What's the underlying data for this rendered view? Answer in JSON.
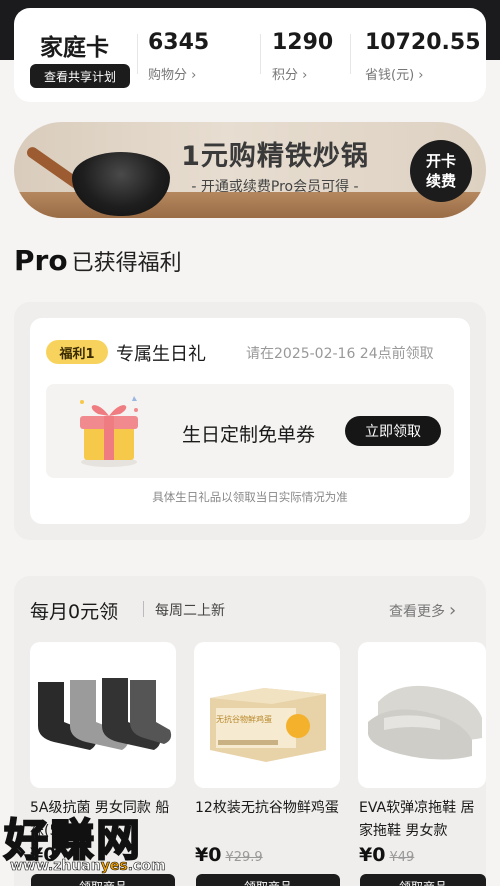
{
  "header": {
    "title": "家庭卡",
    "share_button": "查看共享计划",
    "stats": [
      {
        "value": "6345",
        "label": "购物分"
      },
      {
        "value": "1290",
        "label": "积分"
      },
      {
        "value": "10720.55",
        "label": "省钱(元)"
      }
    ]
  },
  "banner": {
    "title": "1元购精铁炒锅",
    "subtitle": "- 开通或续费Pro会员可得 -",
    "badge_line1": "开卡",
    "badge_line2": "续费"
  },
  "pro_section": {
    "title_bold": "Pro",
    "title_rest": "已获得福利"
  },
  "benefit": {
    "tag": "福利1",
    "name": "专属生日礼",
    "deadline": "请在2025-02-16 24点前领取",
    "coupon_name": "生日定制免单券",
    "claim_button": "立即领取",
    "note": "具体生日礼品以领取当日实际情况为准"
  },
  "monthly": {
    "title": "每月0元领",
    "subtitle": "每周二上新",
    "see_more": "查看更多",
    "products": [
      {
        "name": "5A级抗菌 男女同款 船袜(5双装)",
        "price": "¥0",
        "old_price": "",
        "button": "领取商品"
      },
      {
        "name": "12枚装无抗谷物鲜鸡蛋",
        "price": "¥0",
        "old_price": "¥29.9",
        "button": "领取商品",
        "box_text": "无抗谷物鲜鸡蛋"
      },
      {
        "name": "EVA软弹凉拖鞋 居家拖鞋 男女款",
        "price": "¥0",
        "old_price": "¥49",
        "button": "领取商品"
      }
    ]
  },
  "watermark": {
    "text": "好赚网",
    "url_pre": "www.zhuan",
    "url_accent": "yes",
    "url_post": ".com"
  },
  "colors": {
    "dark": "#1b1b1d",
    "pill_yellow": "#f7d35e",
    "panel": "#efeeec"
  }
}
